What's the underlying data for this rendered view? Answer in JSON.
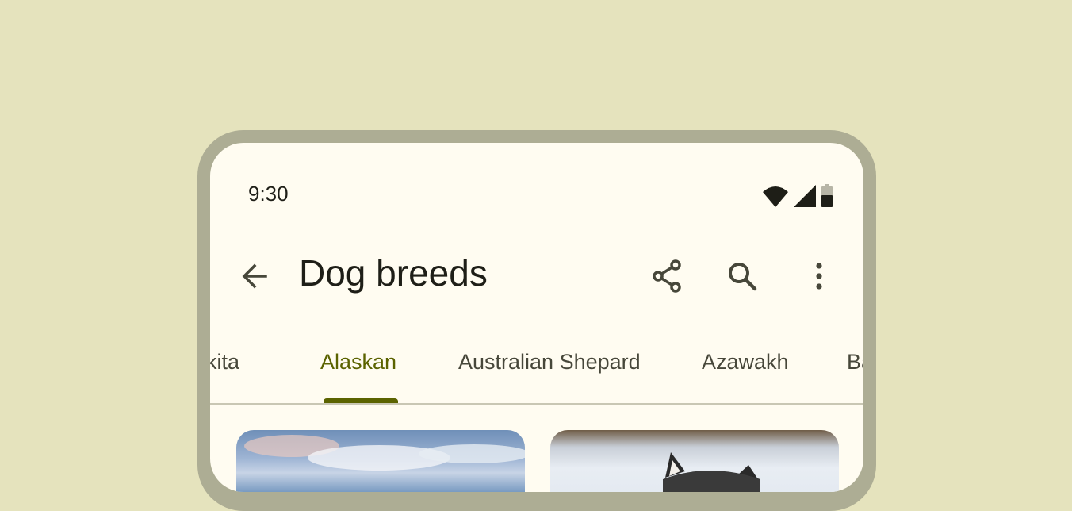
{
  "status_bar": {
    "time": "9:30",
    "icons": [
      "wifi-icon",
      "cell-signal-icon",
      "battery-icon"
    ]
  },
  "app_bar": {
    "title": "Dog breeds",
    "icons": [
      "back-arrow-icon",
      "share-icon",
      "search-icon",
      "more-vert-icon"
    ]
  },
  "tabs": [
    {
      "label": "kita",
      "active": false
    },
    {
      "label": "Alaskan",
      "active": true
    },
    {
      "label": "Australian Shepard",
      "active": false
    },
    {
      "label": "Azawakh",
      "active": false
    },
    {
      "label": "Ba",
      "active": false
    }
  ],
  "cards": [
    {
      "image": "sky-landscape-photo"
    },
    {
      "image": "husky-dog-photo"
    }
  ],
  "colors": {
    "background": "#e5e3bd",
    "frame": "#adad94",
    "surface": "#fffcf1",
    "on_surface": "#1e1e17",
    "accent": "#5b6300",
    "tab_text": "#47473a"
  }
}
